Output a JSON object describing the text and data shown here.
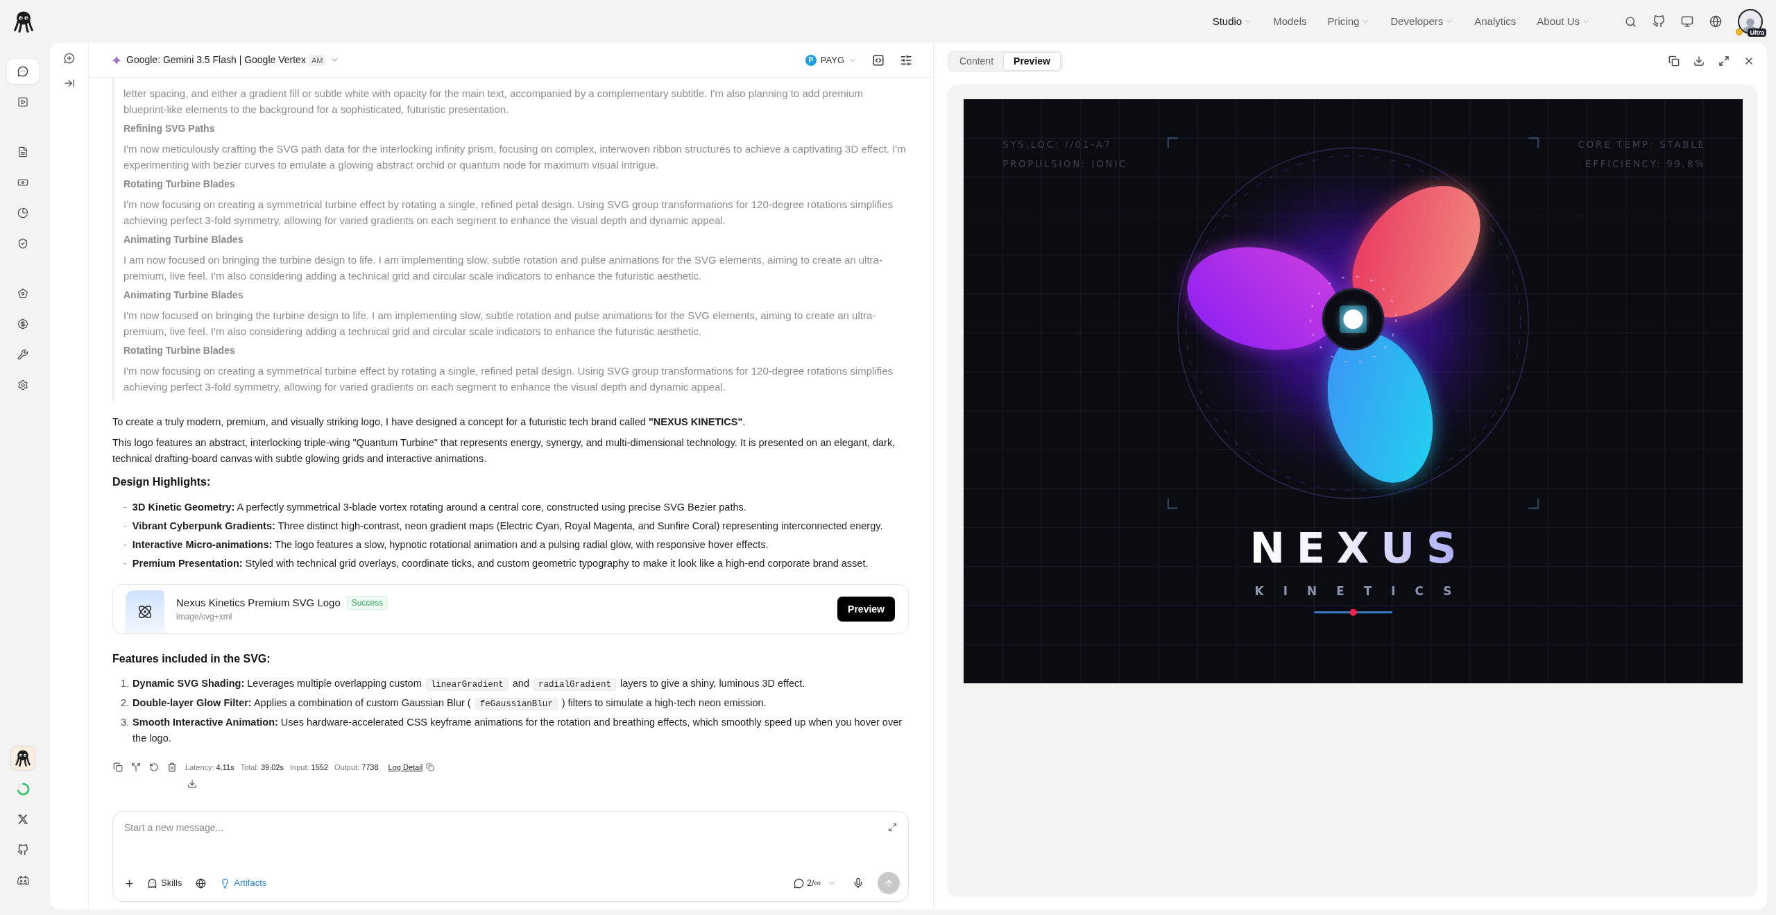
{
  "top_nav": {
    "items": [
      {
        "label": "Studio",
        "selected": true,
        "dropdown": true
      },
      {
        "label": "Models",
        "selected": false,
        "dropdown": false
      },
      {
        "label": "Pricing",
        "selected": false,
        "dropdown": true
      },
      {
        "label": "Developers",
        "selected": false,
        "dropdown": true
      },
      {
        "label": "Analytics",
        "selected": false,
        "dropdown": false
      },
      {
        "label": "About Us",
        "selected": false,
        "dropdown": true
      }
    ],
    "user_badge": "Ultra"
  },
  "sidebar": {
    "sections": [
      {
        "items": [
          {
            "kind": "chat",
            "selected": true
          },
          {
            "kind": "video",
            "selected": false
          }
        ]
      },
      {
        "items": [
          {
            "kind": "document",
            "selected": false
          },
          {
            "kind": "banknote",
            "selected": false
          },
          {
            "kind": "chart",
            "selected": false
          },
          {
            "kind": "shield",
            "selected": false
          }
        ]
      },
      {
        "items": [
          {
            "kind": "badge",
            "selected": false
          },
          {
            "kind": "coin",
            "selected": false
          },
          {
            "kind": "tools",
            "selected": false
          },
          {
            "kind": "settings",
            "selected": false
          }
        ]
      }
    ]
  },
  "chat_header": {
    "model": "Google: Gemini 3.5 Flash | Google Vertex",
    "model_tag": "AM",
    "plan_logo": "P",
    "plan": "PAYG"
  },
  "reasoning": {
    "intro": "letter spacing, and either a gradient fill or subtle white with opacity for the main text, accompanied by a complementary subtitle. I'm also planning to add premium blueprint-like elements to the background for a sophisticated, futuristic presentation.",
    "steps": [
      {
        "title": "Refining SVG Paths",
        "text": "I'm now meticulously crafting the SVG path data for the interlocking infinity prism, focusing on complex, interwoven ribbon structures to achieve a captivating 3D effect. I'm experimenting with bezier curves to emulate a glowing abstract orchid or quantum node for maximum visual intrigue."
      },
      {
        "title": "Rotating Turbine Blades",
        "text": "I'm now focusing on creating a symmetrical turbine effect by rotating a single, refined petal design. Using SVG group transformations for 120-degree rotations simplifies achieving perfect 3-fold symmetry, allowing for varied gradients on each segment to enhance the visual depth and dynamic appeal."
      },
      {
        "title": "Animating Turbine Blades",
        "text": "I am now focused on bringing the turbine design to life. I am implementing slow, subtle rotation and pulse animations for the SVG elements, aiming to create an ultra-premium, live feel. I'm also considering adding a technical grid and circular scale indicators to enhance the futuristic aesthetic."
      },
      {
        "title": "Animating Turbine Blades",
        "text": "I'm now focused on bringing the turbine design to life. I am implementing slow, subtle rotation and pulse animations for the SVG elements, aiming to create an ultra-premium, live feel. I'm also considering adding a technical grid and circular scale indicators to enhance the futuristic aesthetic."
      },
      {
        "title": "Rotating Turbine Blades",
        "text": "I'm now focusing on creating a symmetrical turbine effect by rotating a single, refined petal design. Using SVG group transformations for 120-degree rotations simplifies achieving perfect 3-fold symmetry, allowing for varied gradients on each segment to enhance the visual depth and dynamic appeal."
      }
    ]
  },
  "answer": {
    "paragraphs": [
      "To create a truly modern, premium, and visually striking logo, I have designed a concept for a futuristic tech brand called **\"NEXUS KINETICS\"**.",
      "This logo features an abstract, interlocking triple-wing \"Quantum Turbine\" that represents energy, synergy, and multi-dimensional technology. It is presented on an elegant, dark, technical drafting-board canvas with subtle glowing grids and interactive animations."
    ],
    "highlights_title": "Design Highlights:",
    "highlights": [
      {
        "marker": "-",
        "text": "**3D Kinetic Geometry:** A perfectly symmetrical 3-blade vortex rotating around a central core, constructed using precise SVG Bezier paths."
      },
      {
        "marker": "-",
        "text": "**Vibrant Cyberpunk Gradients:** Three distinct high-contrast, neon gradient maps (Electric Cyan, Royal Magenta, and Sunfire Coral) representing interconnected energy."
      },
      {
        "marker": "-",
        "text": "**Interactive Micro-animations:** The logo features a slow, hypnotic rotational animation and a pulsing radial glow, with responsive hover effects."
      },
      {
        "marker": "-",
        "text": "**Premium Presentation:** Styled with technical grid overlays, coordinate ticks, and custom geometric typography to make it look like a high-end corporate brand asset."
      }
    ],
    "artifact": {
      "title": "Nexus Kinetics Premium SVG Logo",
      "status": "Success",
      "mime": "image/svg+xml",
      "button": "Preview"
    },
    "features_title": "Features included in the SVG:",
    "features": [
      {
        "number": "1.",
        "segments": [
          {
            "kind": "text",
            "text": "**Dynamic SVG Shading:** Leverages multiple overlapping custom"
          },
          {
            "kind": "code",
            "text": "linearGradient"
          },
          {
            "kind": "text",
            "text": "and"
          },
          {
            "kind": "code",
            "text": "radialGradient"
          },
          {
            "kind": "text",
            "text": "layers to give a shiny, luminous 3D effect."
          }
        ]
      },
      {
        "number": "2.",
        "segments": [
          {
            "kind": "text",
            "text": "**Double-layer Glow Filter:** Applies a combination of custom Gaussian Blur ("
          },
          {
            "kind": "code",
            "text": "feGaussianBlur"
          },
          {
            "kind": "text",
            "text": ") filters to simulate a high-tech neon emission."
          }
        ]
      },
      {
        "number": "3.",
        "segments": [
          {
            "kind": "text",
            "text": "**Smooth Interactive Animation:** Uses hardware-accelerated CSS keyframe animations for the rotation and breathing effects, which smoothly speed up when you hover over the logo."
          }
        ]
      }
    ]
  },
  "message_meta": {
    "stats": [
      {
        "label": "Latency:",
        "value": "4.11s"
      },
      {
        "label": "Total:",
        "value": "39.02s"
      },
      {
        "label": "Input:",
        "value": "1552"
      },
      {
        "label": "Output:",
        "value": "7738"
      }
    ],
    "log_link": "Log Detail"
  },
  "composer": {
    "placeholder": "Start a new message...",
    "tools": [
      {
        "kind": "skills",
        "label": "Skills",
        "active": false
      },
      {
        "kind": "web",
        "active": false
      },
      {
        "kind": "artifacts",
        "label": "Artifacts",
        "active": true
      }
    ],
    "turns": "2/∞",
    "send_disabled": true
  },
  "preview_panel": {
    "tabs": [
      {
        "label": "Content",
        "selected": false
      },
      {
        "label": "Preview",
        "selected": true
      }
    ],
    "preview": {
      "corner_left": [
        "SYS.LOC: //01-A7",
        "PROPULSION: IONIC"
      ],
      "corner_right": [
        "CORE TEMP: STABLE",
        "EFFICIENCY: 99.8%"
      ],
      "wordmark": "NEXUS",
      "tagline": "KINETICS"
    }
  }
}
